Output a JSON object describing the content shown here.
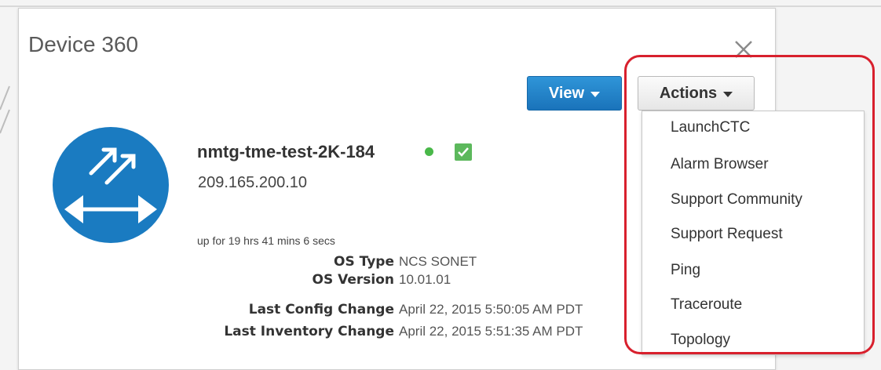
{
  "dialog": {
    "title": "Device 360",
    "view_button": "View",
    "actions_button": "Actions"
  },
  "device": {
    "name": "nmtg-tme-test-2K-184",
    "ip": "209.165.200.10",
    "uptime": "up for 19 hrs 41 mins 6 secs",
    "status_color": "#49b849",
    "properties": [
      {
        "label": "OS Type",
        "value": "NCS SONET"
      },
      {
        "label": "OS Version",
        "value": "10.01.01"
      },
      {
        "label": "Last Config Change",
        "value": "April 22, 2015 5:50:05 AM PDT"
      },
      {
        "label": "Last Inventory Change",
        "value": "April 22, 2015 5:51:35 AM PDT"
      }
    ]
  },
  "actions_menu": {
    "items": [
      {
        "label": "LaunchCTC"
      },
      {
        "label": "Alarm Browser"
      },
      {
        "label": "Support Community"
      },
      {
        "label": "Support Request"
      },
      {
        "label": "Ping"
      },
      {
        "label": "Traceroute"
      },
      {
        "label": "Topology"
      }
    ]
  },
  "colors": {
    "accent_blue": "#1a73ba",
    "highlight_red": "#d8202d",
    "device_icon_blue": "#1a7bc1"
  }
}
